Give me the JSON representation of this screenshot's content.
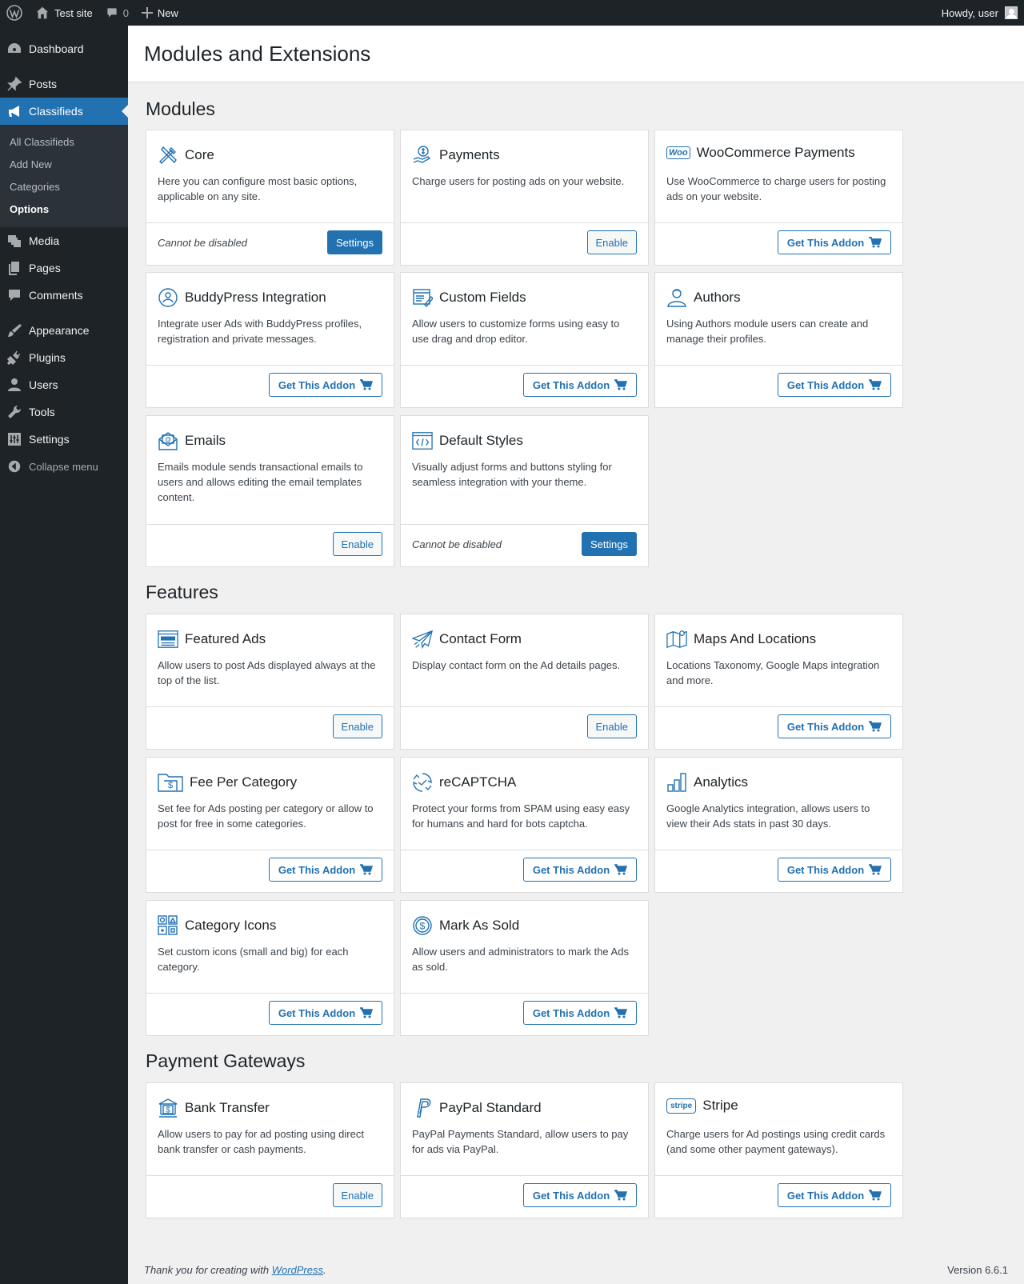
{
  "adminbar": {
    "site_name": "Test site",
    "comment_count": "0",
    "new_label": "New",
    "howdy": "Howdy, user"
  },
  "sidebar": {
    "items": [
      {
        "label": "Dashboard",
        "icon": "dashboard-icon"
      },
      {
        "label": "Posts",
        "icon": "pin-icon"
      },
      {
        "label": "Classifieds",
        "icon": "megaphone-icon"
      },
      {
        "label": "Media",
        "icon": "media-icon"
      },
      {
        "label": "Pages",
        "icon": "pages-icon"
      },
      {
        "label": "Comments",
        "icon": "comment-icon"
      },
      {
        "label": "Appearance",
        "icon": "brush-icon"
      },
      {
        "label": "Plugins",
        "icon": "plug-icon"
      },
      {
        "label": "Users",
        "icon": "user-icon"
      },
      {
        "label": "Tools",
        "icon": "wrench-icon"
      },
      {
        "label": "Settings",
        "icon": "sliders-icon"
      }
    ],
    "submenu": [
      "All Classifieds",
      "Add New",
      "Categories",
      "Options"
    ],
    "collapse": "Collapse menu"
  },
  "page": {
    "title": "Modules and Extensions"
  },
  "sections": {
    "modules": "Modules",
    "features": "Features",
    "gateways": "Payment Gateways"
  },
  "labels": {
    "settings": "Settings",
    "enable": "Enable",
    "get_addon": "Get This Addon",
    "cannot_disable": "Cannot be disabled"
  },
  "modules": [
    {
      "title": "Core",
      "icon": "tools-icon",
      "desc": "Here you can configure most basic options, applicable on any site."
    },
    {
      "title": "Payments",
      "icon": "payment-hand-icon",
      "desc": "Charge users for posting ads on your website."
    },
    {
      "title": "WooCommerce Payments",
      "icon": "woo-logo-icon",
      "logo_text": "Woo",
      "desc": "Use WooCommerce to charge users for posting ads on your website."
    },
    {
      "title": "BuddyPress Integration",
      "icon": "buddypress-icon",
      "desc": "Integrate user Ads with BuddyPress profiles, registration and private messages."
    },
    {
      "title": "Custom Fields",
      "icon": "form-fields-icon",
      "desc": "Allow users to customize forms using easy to use drag and drop editor."
    },
    {
      "title": "Authors",
      "icon": "author-icon",
      "desc": "Using Authors module users can create and manage their profiles."
    },
    {
      "title": "Emails",
      "icon": "email-icon",
      "desc": "Emails module sends transactional emails to users and allows editing the email templates content."
    },
    {
      "title": "Default Styles",
      "icon": "code-icon",
      "desc": "Visually adjust forms and buttons styling for seamless integration with your theme."
    }
  ],
  "features": [
    {
      "title": "Featured Ads",
      "icon": "featured-ads-icon",
      "desc": "Allow users to post Ads displayed always at the top of the list."
    },
    {
      "title": "Contact Form",
      "icon": "paper-plane-icon",
      "desc": "Display contact form on the Ad details pages."
    },
    {
      "title": "Maps And Locations",
      "icon": "map-icon",
      "desc": "Locations Taxonomy, Google Maps integration and more."
    },
    {
      "title": "Fee Per Category",
      "icon": "fee-folder-icon",
      "desc": "Set fee for Ads posting per category or allow to post for free in some categories."
    },
    {
      "title": "reCAPTCHA",
      "icon": "recaptcha-icon",
      "desc": "Protect your forms from SPAM using easy easy for humans and hard for bots captcha."
    },
    {
      "title": "Analytics",
      "icon": "analytics-icon",
      "desc": "Google Analytics integration, allows users to view their Ads stats in past 30 days."
    },
    {
      "title": "Category Icons",
      "icon": "category-grid-icon",
      "desc": "Set custom icons (small and big) for each category."
    },
    {
      "title": "Mark As Sold",
      "icon": "dollar-circle-icon",
      "desc": "Allow users and administrators to mark the Ads as sold."
    }
  ],
  "gateways": [
    {
      "title": "Bank Transfer",
      "icon": "bank-icon",
      "desc": "Allow users to pay for ad posting using direct bank transfer or cash payments."
    },
    {
      "title": "PayPal Standard",
      "icon": "paypal-icon",
      "desc": "PayPal Payments Standard, allow users to pay for ads via PayPal."
    },
    {
      "title": "Stripe",
      "icon": "stripe-logo-icon",
      "logo_text": "stripe",
      "desc": "Charge users for Ad postings using credit cards (and some other payment gateways)."
    }
  ],
  "footer": {
    "thanks": "Thank you for creating with",
    "link": "WordPress",
    "period": ".",
    "version": "Version 6.6.1"
  },
  "colors": {
    "accent": "#2271b1",
    "sidebar_bg": "#1d2327",
    "submenu_bg": "#2c3338",
    "page_bg": "#f0f0f1"
  }
}
